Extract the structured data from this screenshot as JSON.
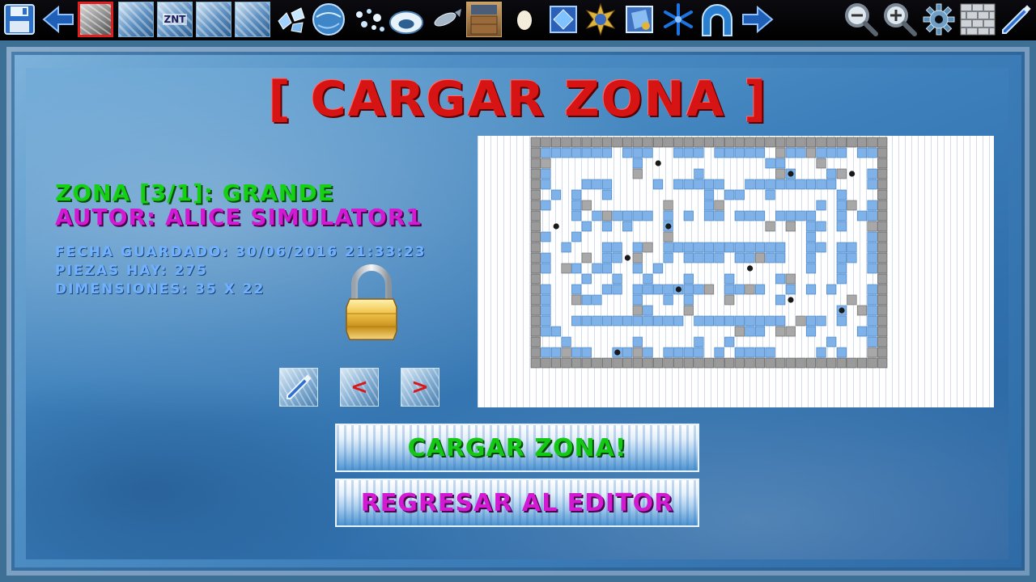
{
  "toolbar": {
    "tile_label": "ZNT"
  },
  "title": "[ CARGAR ZONA ]",
  "zone": {
    "zona_line": "ZONA [3/1]: GRANDE",
    "autor_line": "AUTOR: ALICE SIMULATOR1",
    "fecha_line": "FECHA GUARDADO: 30/06/2016 21:33:23",
    "piezas_line": "PIEZAS HAY: 275",
    "dim_line": "DIMENSIONES: 35 X 22"
  },
  "nav": {
    "prev_label": "<",
    "next_label": ">"
  },
  "buttons": {
    "load_label": "CARGAR ZONA!",
    "back_label": "REGRESAR AL EDITOR"
  },
  "colors": {
    "title": "#d61414",
    "zona": "#16d016",
    "autor": "#d21ad2",
    "meta": "#6fb0ff"
  },
  "icons": {
    "lock": "padlock-icon",
    "save": "floppy-disk-icon",
    "back": "arrow-left-icon",
    "forward": "arrow-right-icon",
    "zoom_out": "zoom-out-icon",
    "zoom_in": "zoom-in-icon",
    "settings": "gear-icon",
    "grid": "brick-wall-icon",
    "edit": "pencil-icon"
  },
  "map_preview": {
    "cols": 35,
    "rows": 22
  }
}
